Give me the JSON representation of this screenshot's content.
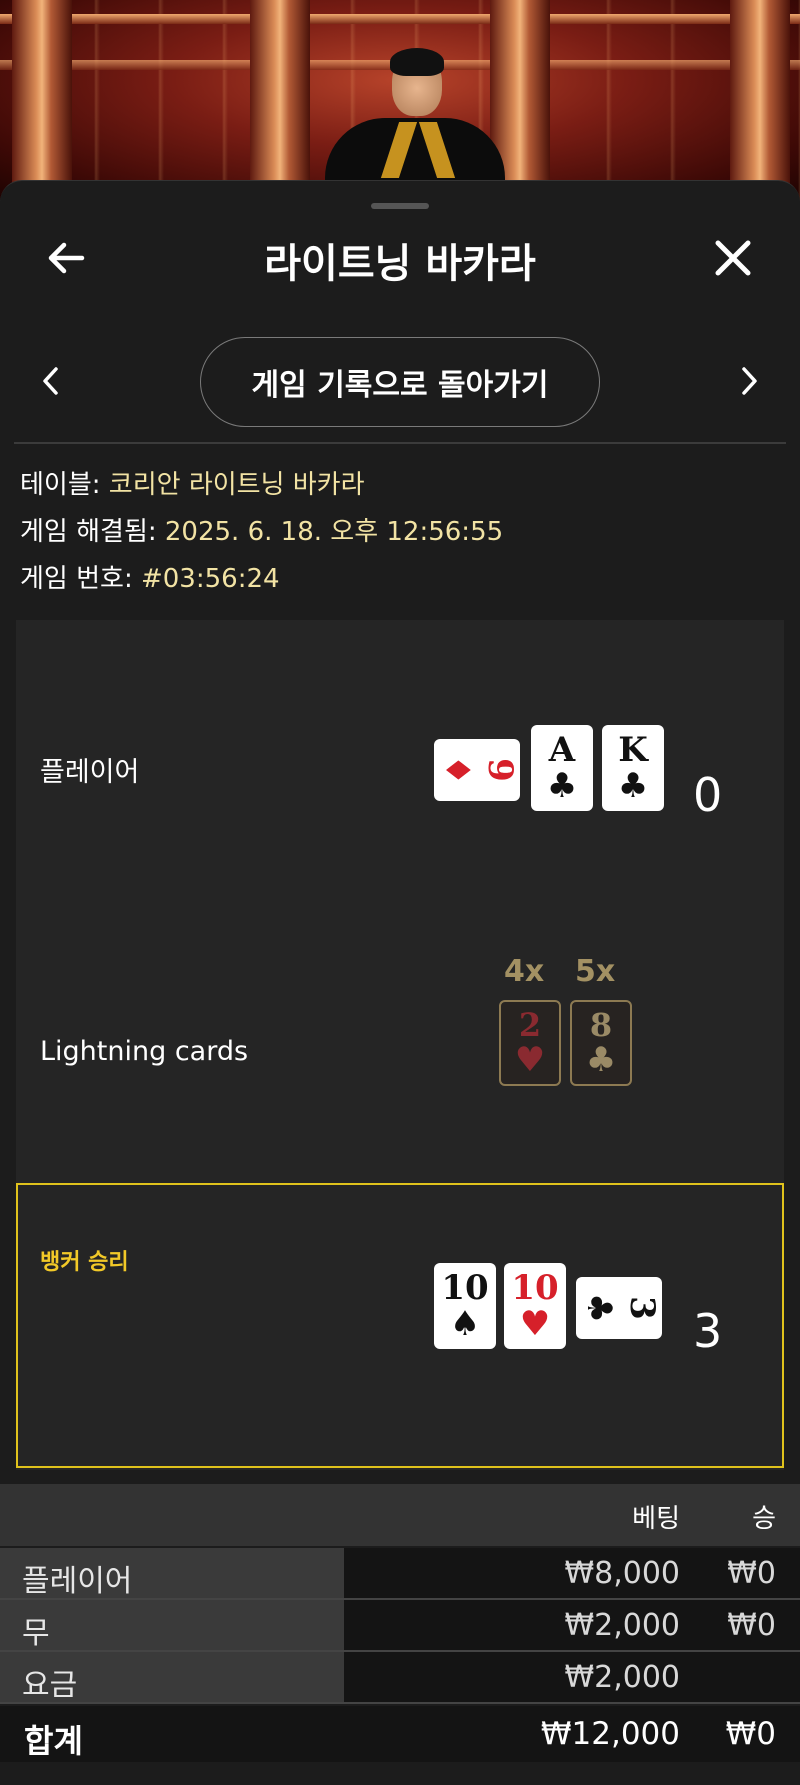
{
  "header": {
    "title": "라이트닝 바카라",
    "back_icon": "arrow-left-icon",
    "close_icon": "close-icon"
  },
  "nav": {
    "prev_icon": "chevron-left-icon",
    "next_icon": "chevron-right-icon",
    "return_label": "게임 기록으로 돌아가기"
  },
  "info": {
    "table_label": "테이블:",
    "table_value": "코리안 라이트닝 바카라",
    "resolved_label": "게임 해결됨:",
    "resolved_value": "2025. 6. 18. 오후 12:56:55",
    "number_label": "게임 번호:",
    "number_value": "#03:56:24"
  },
  "result": {
    "player": {
      "label": "플레이어",
      "score": "0",
      "cards": [
        {
          "rank": "9",
          "suit": "♦",
          "color": "red",
          "orientation": "sideways"
        },
        {
          "rank": "A",
          "suit": "♣",
          "color": "black",
          "orientation": "upright"
        },
        {
          "rank": "K",
          "suit": "♣",
          "color": "black",
          "orientation": "upright"
        }
      ]
    },
    "lightning": {
      "label": "Lightning cards",
      "cards": [
        {
          "multiplier": "4x",
          "rank": "2",
          "suit": "♥",
          "color": "red"
        },
        {
          "multiplier": "5x",
          "rank": "8",
          "suit": "♣",
          "color": "black"
        }
      ]
    },
    "banker": {
      "label": "뱅커 승리",
      "score": "3",
      "highlight_color": "#e0c21c",
      "cards": [
        {
          "rank": "10",
          "suit": "♠",
          "color": "black",
          "orientation": "upright"
        },
        {
          "rank": "10",
          "suit": "♥",
          "color": "red",
          "orientation": "upright"
        },
        {
          "rank": "3",
          "suit": "♣",
          "color": "black",
          "orientation": "sideways"
        }
      ]
    }
  },
  "bets": {
    "columns": {
      "bet": "베팅",
      "win": "승"
    },
    "rows": [
      {
        "label": "플레이어",
        "bet": "₩8,000",
        "win": "₩0"
      },
      {
        "label": "무",
        "bet": "₩2,000",
        "win": "₩0"
      },
      {
        "label": "요금",
        "bet": "₩2,000",
        "win": ""
      }
    ],
    "total": {
      "label": "합계",
      "bet": "₩12,000",
      "win": "₩0"
    }
  },
  "colors": {
    "accent_value": "#f2e3a4",
    "banker_gold": "#f2c928",
    "lightning_gold": "#a39163"
  }
}
